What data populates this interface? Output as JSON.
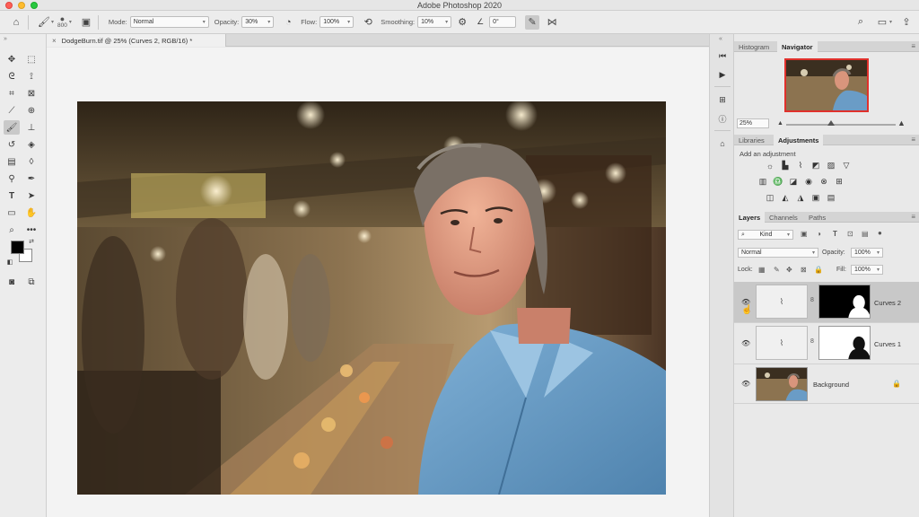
{
  "app": {
    "title": "Adobe Photoshop 2020"
  },
  "options": {
    "brush_size": "800",
    "mode_label": "Mode:",
    "mode_value": "Normal",
    "opacity_label": "Opacity:",
    "opacity_value": "30%",
    "flow_label": "Flow:",
    "flow_value": "100%",
    "smoothing_label": "Smoothing:",
    "smoothing_value": "10%",
    "angle_value": "0°"
  },
  "document": {
    "tab_title": "DodgeBurn.tif @ 25% (Curves 2, RGB/16) *"
  },
  "navigator_group": {
    "tabs": [
      "Histogram",
      "Navigator"
    ],
    "zoom": "25%"
  },
  "adjust_group": {
    "tabs": [
      "Libraries",
      "Adjustments"
    ],
    "add_label": "Add an adjustment"
  },
  "layers_group": {
    "tabs": [
      "Layers",
      "Channels",
      "Paths"
    ],
    "filter_kind": "Kind",
    "blend_mode": "Normal",
    "opacity_label": "Opacity:",
    "opacity_value": "100%",
    "lock_label": "Lock:",
    "fill_label": "Fill:",
    "fill_value": "100%",
    "layers": [
      {
        "name": "Curves 2"
      },
      {
        "name": "Curves 1"
      },
      {
        "name": "Background"
      }
    ]
  },
  "colors": {
    "accent_red": "#e0312c",
    "selected_row": "#c8c8c8",
    "canvas_bg": "#f3f3f3",
    "shirt_blue": "#6a9cc6"
  }
}
